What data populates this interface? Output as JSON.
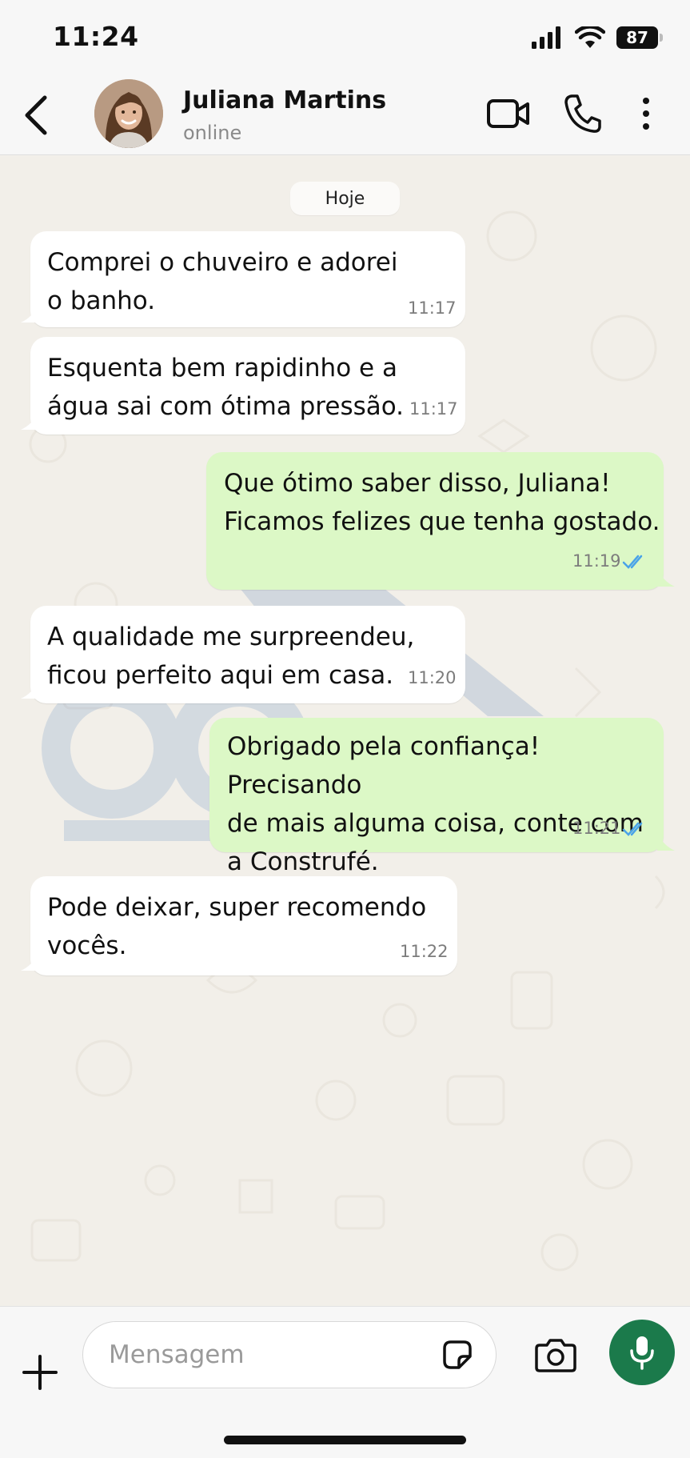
{
  "status_bar": {
    "time": "11:24",
    "battery": "87"
  },
  "header": {
    "contact_name": "Juliana Martins",
    "contact_status": "online",
    "avatar_icon": "contact-avatar"
  },
  "date_chip": "Hoje",
  "messages": [
    {
      "direction": "in",
      "text": "Comprei o chuveiro e adorei\no banho.",
      "time": "11:17"
    },
    {
      "direction": "in",
      "text": "Esquenta bem rapidinho e a\nágua sai com ótima pressão.",
      "time": "11:17"
    },
    {
      "direction": "out",
      "text": "Que ótimo saber disso, Juliana!\nFicamos felizes que tenha gostado.",
      "time": "11:19",
      "read": true
    },
    {
      "direction": "in",
      "text": "A qualidade me surpreendeu,\nficou perfeito aqui em casa.",
      "time": "11:20"
    },
    {
      "direction": "out",
      "text": "Obrigado pela confiança! Precisando\nde mais alguma coisa, conte com\na Construfé.",
      "time": "11:21",
      "read": true
    },
    {
      "direction": "in",
      "text": "Pode deixar, super recomendo\nvocês.",
      "time": "11:22"
    }
  ],
  "input_bar": {
    "placeholder": "Mensagem"
  },
  "colors": {
    "outgoing_bubble": "#dcf8c6",
    "incoming_bubble": "#ffffff",
    "read_ticks": "#4aa3e8",
    "mic_button": "#1b7a4b"
  }
}
